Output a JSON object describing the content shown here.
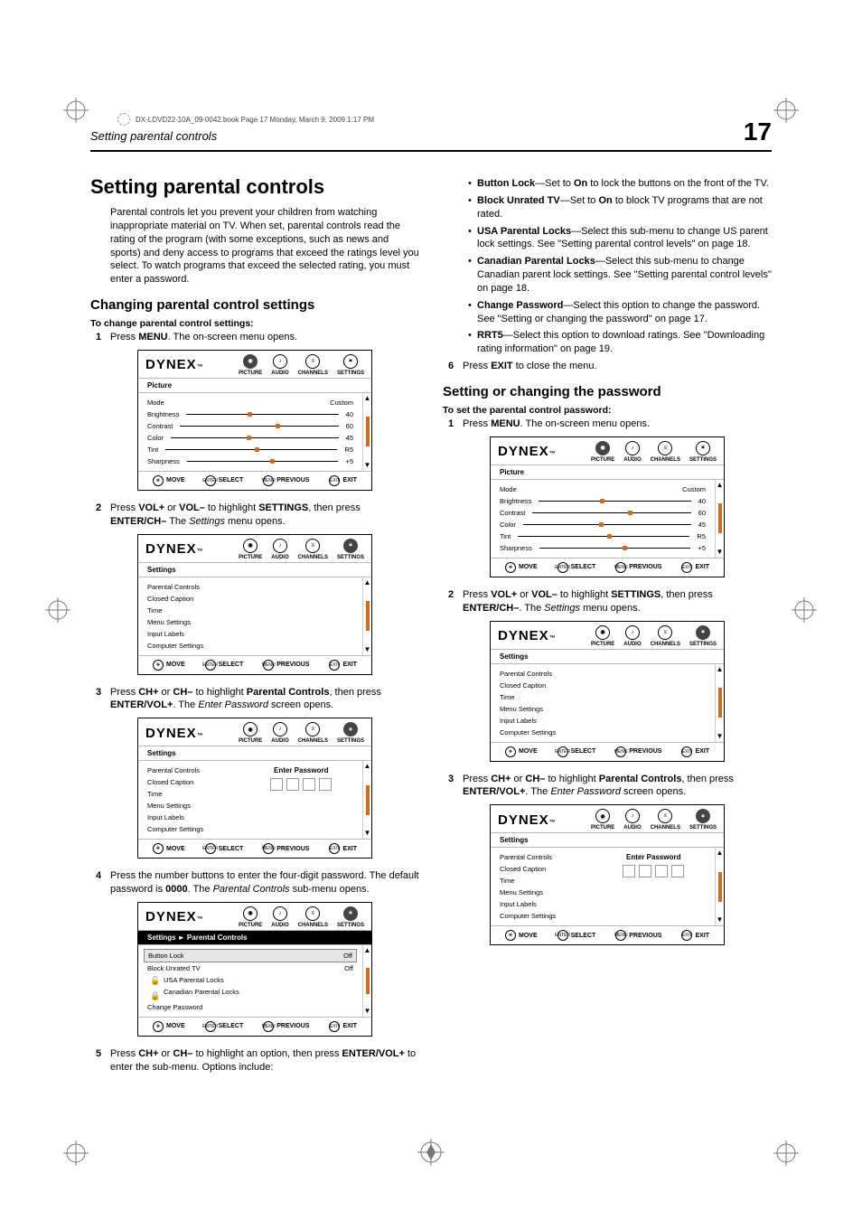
{
  "meta_line": "DX-LDVD22-10A_09-0042.book  Page 17  Monday, March 9, 2009  1:17 PM",
  "header": {
    "left": "Setting parental controls",
    "page": "17"
  },
  "brand": "DYNEX",
  "tabs": {
    "picture": "PICTURE",
    "audio": "AUDIO",
    "channels": "CHANNELS",
    "settings": "SETTINGS"
  },
  "footer": {
    "move": "MOVE",
    "select": "SELECT",
    "previous": "PREVIOUS",
    "exit": "EXIT",
    "enter_label": "ENTER",
    "menu_label": "MENU",
    "exit_label": "EXIT"
  },
  "picture_panel": {
    "cat": "Picture",
    "rows": [
      {
        "label": "Mode",
        "value": "Custom",
        "knob": 0
      },
      {
        "label": "Brightness",
        "value": "40",
        "knob": 40
      },
      {
        "label": "Contrast",
        "value": "60",
        "knob": 60
      },
      {
        "label": "Color",
        "value": "45",
        "knob": 45
      },
      {
        "label": "Tint",
        "value": "R5",
        "knob": 52
      },
      {
        "label": "Sharpness",
        "value": "+5",
        "knob": 55
      }
    ]
  },
  "settings_panel": {
    "cat": "Settings",
    "items": [
      "Parental Controls",
      "Closed Caption",
      "Time",
      "Menu Settings",
      "Input Labels",
      "Computer Settings"
    ]
  },
  "pw_panel": {
    "cat": "Settings",
    "items": [
      "Parental Controls",
      "Closed Caption",
      "Time",
      "Menu Settings",
      "Input Labels",
      "Computer Settings"
    ],
    "prompt": "Enter Password"
  },
  "pc_panel": {
    "cat": "Settings ► Parental Controls",
    "items": [
      {
        "label": "Button Lock",
        "value": "Off",
        "sel": true
      },
      {
        "label": "Block Unrated TV",
        "value": "Off"
      },
      {
        "label": "USA Parental Locks",
        "indent": true,
        "lock": true
      },
      {
        "label": "Canadian Parental Locks",
        "indent": true,
        "lock": true
      },
      {
        "label": "Change Password"
      }
    ]
  },
  "left": {
    "h1": "Setting parental controls",
    "intro": "Parental controls let you prevent your children from watching inappropriate material on TV. When set, parental controls read the rating of the program (with some exceptions, such as news and sports) and deny access to programs that exceed the ratings level you select. To watch programs that exceed the selected rating, you must enter a password.",
    "h2": "Changing parental control settings",
    "to": "To change parental control settings:",
    "s1a": "Press ",
    "s1b": "MENU",
    "s1c": ". The on-screen menu opens.",
    "s2a": "Press ",
    "s2b": "VOL+",
    "s2c": " or ",
    "s2d": "VOL–",
    "s2e": " to highlight ",
    "s2f": "SETTINGS",
    "s2g": ", then press ",
    "s2h": "ENTER/CH–",
    "s2i": " The ",
    "s2j": "Settings",
    "s2k": " menu opens.",
    "s3a": "Press ",
    "s3b": "CH+",
    "s3c": " or ",
    "s3d": "CH–",
    "s3e": " to highlight ",
    "s3f": "Parental Controls",
    "s3g": ", then press ",
    "s3h": "ENTER/VOL+",
    "s3i": ". The ",
    "s3j": "Enter Password",
    "s3k": " screen opens.",
    "s4a": "Press the number buttons to enter the four-digit password. The default password is ",
    "s4b": "0000",
    "s4c": ". The ",
    "s4d": "Parental Controls",
    "s4e": " sub-menu opens.",
    "s5a": "Press ",
    "s5b": "CH+",
    "s5c": " or ",
    "s5d": "CH–",
    "s5e": " to highlight an option, then press ",
    "s5f": "ENTER/VOL+",
    "s5g": " to enter the sub-menu. Options include:"
  },
  "right": {
    "b1a": "Button Lock",
    "b1b": "—Set to ",
    "b1c": "On",
    "b1d": " to lock the buttons on the front of the TV.",
    "b2a": "Block Unrated TV",
    "b2b": "—Set to ",
    "b2c": "On",
    "b2d": " to block TV programs that are not rated.",
    "b3a": "USA Parental Locks",
    "b3b": "—Select this sub-menu to change US parent lock settings. See \"Setting parental control levels\" on page 18.",
    "b4a": "Canadian Parental Locks",
    "b4b": "—Select this sub-menu to change Canadian parent lock settings. See \"Setting parental control levels\" on page 18.",
    "b5a": "Change Password",
    "b5b": "—Select this option to change the password. See \"Setting or changing the password\" on page 17.",
    "b6a": "RRT5",
    "b6b": "—Select this option to download ratings. See \"Downloading rating information\" on page 19.",
    "s6a": "Press ",
    "s6b": "EXIT",
    "s6c": " to close the menu.",
    "h2": "Setting or changing the password",
    "to": "To set the parental control password:",
    "p1a": "Press ",
    "p1b": "MENU",
    "p1c": ". The on-screen menu opens.",
    "p2a": "Press ",
    "p2b": "VOL+",
    "p2c": " or ",
    "p2d": "VOL–",
    "p2e": " to highlight ",
    "p2f": "SETTINGS",
    "p2g": ", then press ",
    "p2h": "ENTER/CH–",
    "p2i": ". The ",
    "p2j": "Settings",
    "p2k": " menu opens.",
    "p3a": "Press ",
    "p3b": "CH+",
    "p3c": " or ",
    "p3d": "CH–",
    "p3e": " to highlight ",
    "p3f": "Parental Controls",
    "p3g": ", then press ",
    "p3h": "ENTER/VOL+",
    "p3i": ". The ",
    "p3j": "Enter Password",
    "p3k": " screen opens."
  }
}
